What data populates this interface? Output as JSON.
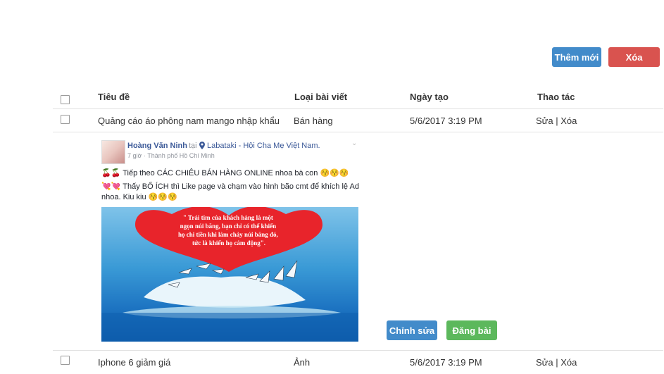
{
  "toolbar": {
    "add_label": "Thêm mới",
    "delete_label": "Xóa"
  },
  "table": {
    "headers": {
      "title": "Tiêu đề",
      "type": "Loại bài viết",
      "date": "Ngày tạo",
      "actions": "Thao tác"
    },
    "rows": [
      {
        "title": "Quảng cáo áo phông nam mango nhập khẩu",
        "type": "Bán hàng",
        "date": "5/6/2017 3:19 PM",
        "edit": "Sửa",
        "sep": "|",
        "delete": "Xóa"
      },
      {
        "title": "Iphone 6 giảm giá",
        "type": "Ảnh",
        "date": "5/6/2017 3:19 PM",
        "edit": "Sửa",
        "sep": "|",
        "delete": "Xóa"
      }
    ]
  },
  "preview": {
    "author": "Hoàng Văn Ninh",
    "at": "tại",
    "place": "Labataki - Hội Cha Mẹ Việt Nam.",
    "meta": "7 giờ · Thành phố Hồ Chí Minh",
    "line1": "🍒🍒 Tiếp theo CÁC CHIÊU BÁN HÀNG ONLINE nhoa bà con 😚😚😚",
    "line2": "💘💘 Thấy BỔ ÍCH thì Like page và chạm vào hình bão cmt để khích lệ Ad",
    "line3": "nhoa. Kiu kiu 😚😚😚",
    "image_quote": [
      "\" Trái tim của khách hàng là một",
      "ngọn núi băng, bạn chỉ có thể khiến",
      "họ chi tiền khi làm chảy núi băng đó,",
      "tức là khiến họ cảm động\"."
    ],
    "edit_label": "Chỉnh sửa",
    "post_label": "Đăng bài"
  }
}
